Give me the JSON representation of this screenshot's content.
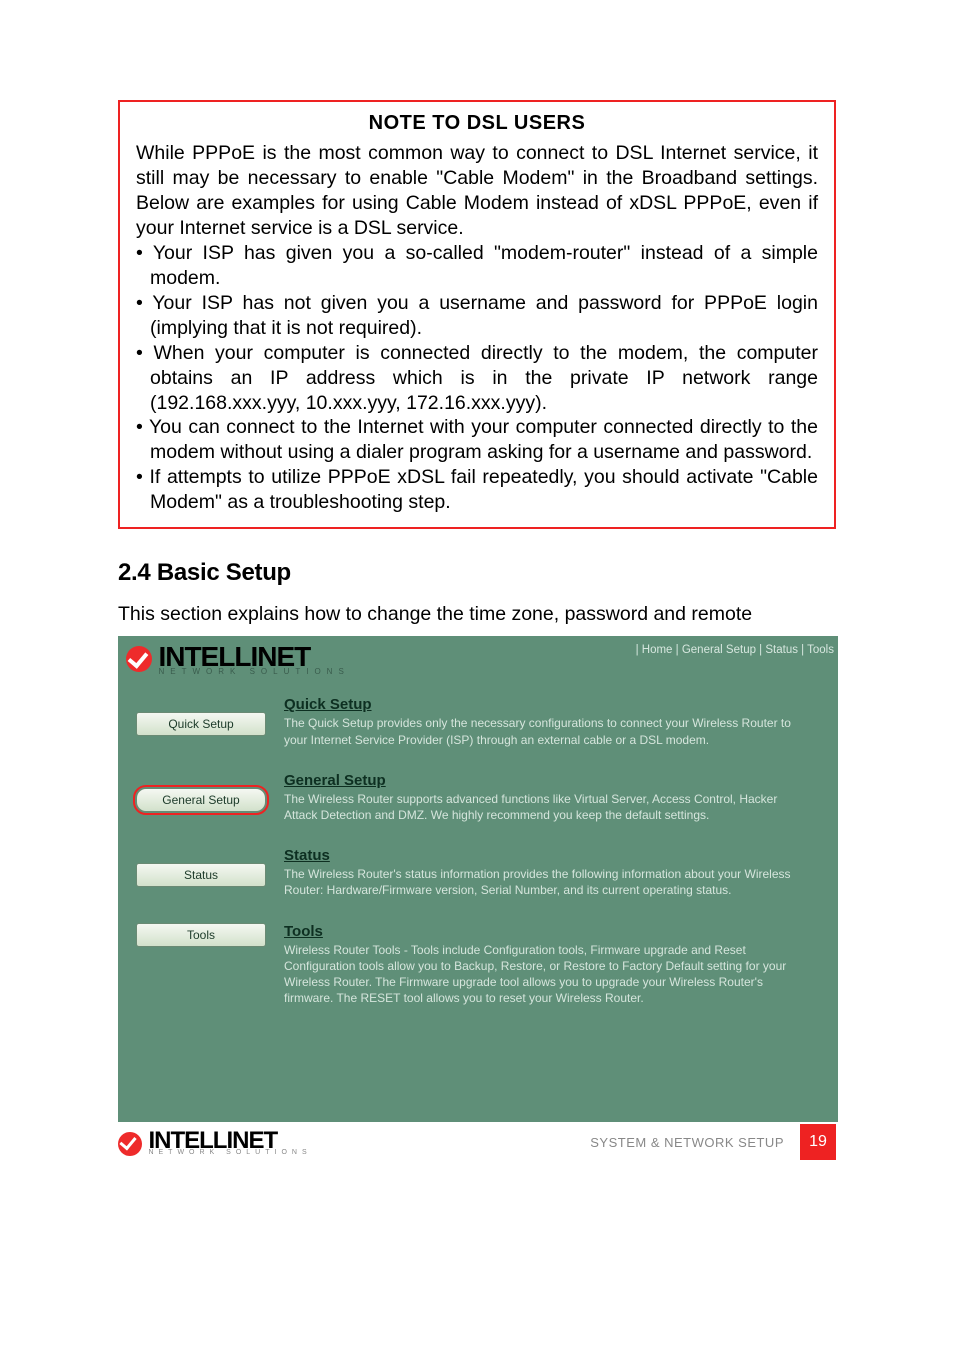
{
  "note": {
    "title": "NOTE TO DSL USERS",
    "intro": "While PPPoE is the most common way to connect to DSL Internet service, it still may be necessary to enable \"Cable Modem\" in the Broadband settings. Below are examples for using Cable Modem instead of xDSL PPPoE, even if your Internet service is a DSL service.",
    "bullets": [
      "Your ISP has given you a so-called \"modem-router\" instead of a simple modem.",
      "Your ISP has not given you a username and password for PPPoE login (implying that it is not required).",
      "When your computer is connected directly to the modem, the computer obtains an IP address which is in the private IP network range (192.168.xxx.yyy, 10.xxx.yyy, 172.16.xxx.yyy).",
      "You can connect to the Internet with your computer connected directly to the modem without using a dialer program asking for a username and password.",
      "If attempts to utilize PPPoE xDSL fail repeatedly, you should activate \"Cable Modem\" as a troubleshooting step."
    ]
  },
  "section": {
    "heading": "2.4  Basic Setup",
    "intro": "This section explains how to change the time zone, password and remote"
  },
  "router": {
    "brand": "INTELLINET",
    "brand_sub": "NETWORK SOLUTIONS",
    "nav": "| Home | General Setup | Status | Tools",
    "items": [
      {
        "button": "Quick Setup",
        "title": "Quick Setup",
        "desc": "The Quick Setup provides only the necessary configurations to connect your Wireless Router to your Internet Service Provider (ISP) through an external cable or a DSL modem."
      },
      {
        "button": "General Setup",
        "title": "General Setup",
        "desc": "The Wireless Router supports advanced functions like Virtual Server, Access Control, Hacker Attack Detection and DMZ. We highly recommend you keep the default settings."
      },
      {
        "button": "Status",
        "title": "Status",
        "desc": "The Wireless Router's status information provides the following information about your Wireless Router: Hardware/Firmware version, Serial Number, and its current operating status."
      },
      {
        "button": "Tools",
        "title": "Tools",
        "desc": "Wireless Router Tools - Tools include Configuration tools, Firmware upgrade and Reset Configuration tools allow you to Backup, Restore, or Restore to Factory Default setting for your Wireless Router. The Firmware upgrade tool allows you to upgrade your Wireless Router's firmware. The RESET tool allows you to reset your Wireless Router."
      }
    ]
  },
  "footer": {
    "brand": "INTELLINET",
    "brand_sub": "NETWORK SOLUTIONS",
    "label": "SYSTEM & NETWORK SETUP",
    "page": "19"
  }
}
